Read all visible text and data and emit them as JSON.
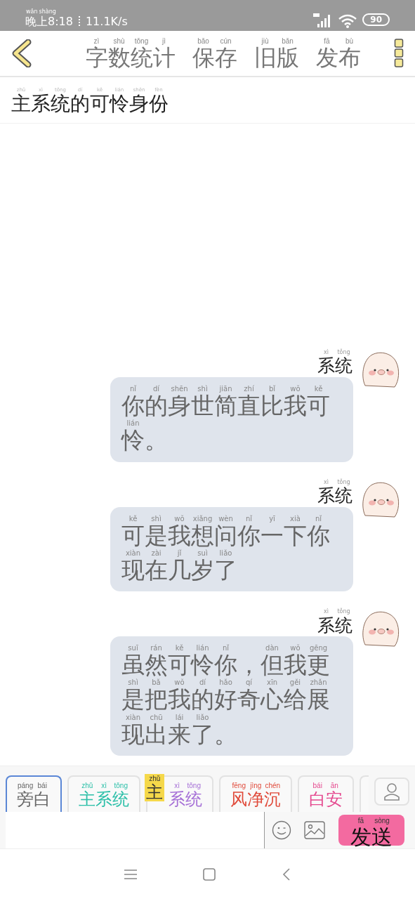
{
  "status_bar": {
    "time": {
      "text": "晚上8:18",
      "pinyin": "wǎn shàng"
    },
    "speed": "11.1K/s",
    "battery": "90"
  },
  "toolbar": {
    "items": [
      {
        "text": "字数统计",
        "pinyin": "zì shù tǒng jì"
      },
      {
        "text": "保存",
        "pinyin": "bǎo cún"
      },
      {
        "text": "旧版",
        "pinyin": "jiù bǎn"
      },
      {
        "text": "发布",
        "pinyin": "fā bù"
      }
    ]
  },
  "title": {
    "text": "主系统的可怜身份",
    "pinyin": "zhǔ xì tǒng dí kě lián shēn fèn"
  },
  "messages": [
    {
      "sender": {
        "text": "系统",
        "pinyin": "xì tǒng"
      },
      "lines": [
        {
          "text": "你的身世简直比我可",
          "pinyin": "nǐ dí shēn shì jiān zhí bǐ wǒ kě"
        },
        {
          "text": "怜。",
          "pinyin": "lián"
        }
      ]
    },
    {
      "sender": {
        "text": "系统",
        "pinyin": "xì tǒng"
      },
      "lines": [
        {
          "text": "可是我想问你一下你",
          "pinyin": "kě shì wǒ xiǎng wèn nǐ yī xià nǐ"
        },
        {
          "text": "现在几岁了",
          "pinyin": "xiàn zài jǐ suì liǎo"
        }
      ]
    },
    {
      "sender": {
        "text": "系统",
        "pinyin": "xì tǒng"
      },
      "lines": [
        {
          "text": "虽然可怜你，但我更",
          "pinyin": "suī rán kě lián nǐ  dàn wǒ gēng"
        },
        {
          "text": "是把我的好奇心给展",
          "pinyin": "shì bǎ wǒ dí hǎo qí xīn gěi zhǎn"
        },
        {
          "text": "现出来了。",
          "pinyin": "xiàn chū lái liǎo"
        }
      ]
    }
  ],
  "roles": [
    {
      "text": "旁白",
      "pinyin": "páng bái",
      "color": "#666666",
      "selected": true
    },
    {
      "text": "主系统",
      "pinyin": "zhǔ xì tǒng",
      "color": "#2bbfa8",
      "selected": false
    },
    {
      "text": "系统",
      "pinyin": "xì tǒng",
      "color": "#a56fd6",
      "selected": false,
      "tag": {
        "text": "主",
        "pinyin": "zhǔ"
      }
    },
    {
      "text": "风净沉",
      "pinyin": "fēng jìng chén",
      "color": "#e04a3a",
      "selected": false
    },
    {
      "text": "白安",
      "pinyin": "bái ān",
      "color": "#e5498f",
      "selected": false
    }
  ],
  "composer": {
    "send": {
      "text": "发送",
      "pinyin": "fā sòng"
    }
  }
}
